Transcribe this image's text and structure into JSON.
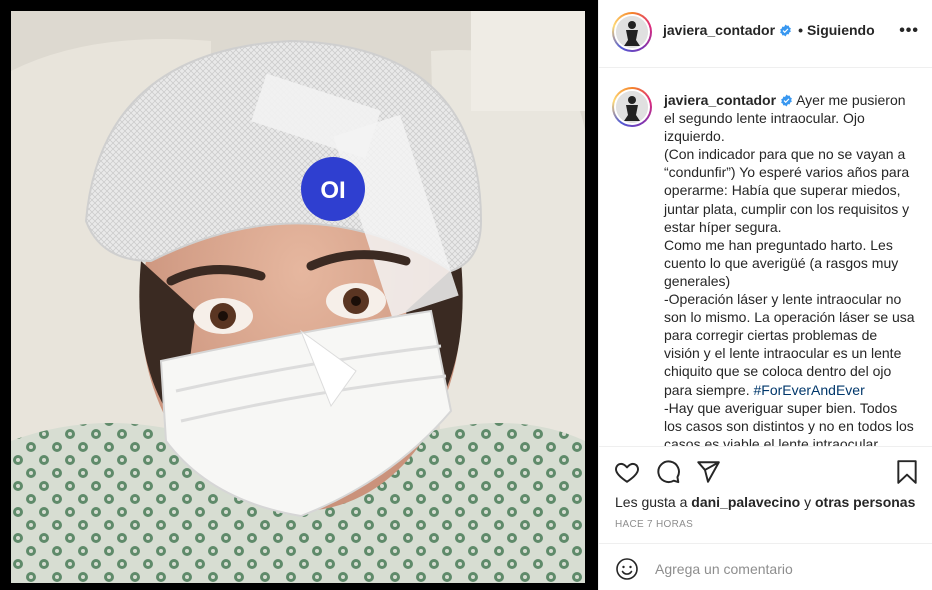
{
  "post": {
    "username": "javiera_contador",
    "follow_status": "Siguiendo",
    "header_dot": "•",
    "more_label": "•••",
    "verified": true,
    "avatar_icon": "profile-photo-icon"
  },
  "photo": {
    "forehead_sticker_text": "OI",
    "description_icon": "post-photo"
  },
  "caption": {
    "username": "javiera_contador",
    "paragraphs": [
      "Ayer me pusieron el segundo lente intraocular. Ojo izquierdo.",
      "(Con indicador para que no se vayan a “condunfir”) Yo esperé varios años para operarme: Había que superar miedos, juntar plata, cumplir con los requisitos y estar híper segura.",
      "Como me han preguntado harto. Les cuento lo que averigüé (a rasgos muy generales)",
      "-Operación láser y lente intraocular no son lo mismo. La operación láser se usa para corregir ciertas problemas de visión y el lente intraocular es un lente chiquito que se coloca dentro del ojo para siempre.",
      "-Hay que averiguar super bien. Todos los casos son distintos y no en todos los casos es viable el lente intraocular."
    ],
    "hashtag": "#ForEverAndEver"
  },
  "actions": {
    "like_icon": "heart-icon",
    "comment_icon": "comment-icon",
    "share_icon": "send-icon",
    "save_icon": "bookmark-icon"
  },
  "likes": {
    "prefix": "Les gusta a",
    "user": "dani_palavecino",
    "connector": "y",
    "others": "otras personas"
  },
  "time_ago": "HACE 7 HORAS",
  "comment": {
    "placeholder": "Agrega un comentario",
    "emoji_icon": "smiley-icon"
  },
  "colors": {
    "link": "#00376b",
    "muted": "#8e8e8e",
    "text": "#262626",
    "verified": "#3897f0",
    "sticker": "#2f3fd0"
  }
}
